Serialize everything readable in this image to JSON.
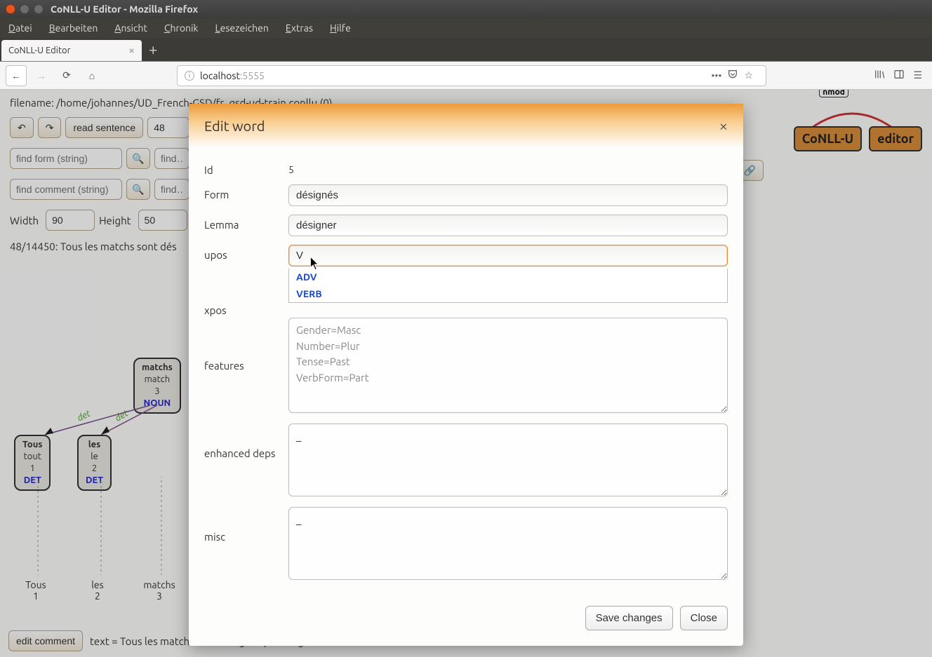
{
  "window": {
    "title": "CoNLL-U Editor - Mozilla Firefox"
  },
  "menu": {
    "items": [
      "Datei",
      "Bearbeiten",
      "Ansicht",
      "Chronik",
      "Lesezeichen",
      "Extras",
      "Hilfe"
    ]
  },
  "tab": {
    "title": "CoNLL-U Editor"
  },
  "url": {
    "host": "localhost",
    "port": ":5555"
  },
  "page": {
    "filename_label": "filename: /home/johannes/UD_French-GSD/fr_gsd-ud-train.conllu (0)",
    "read_button": "read sentence",
    "read_value": "48",
    "find_form_placeholder": "find form (string)",
    "find_right_placeholder": "find…",
    "find_comment_placeholder": "find comment (string)",
    "find_right2_placeholder": "find…",
    "width_label": "Width",
    "width_value": "90",
    "height_label": "Height",
    "height_value": "50",
    "sentence_counter": "48/14450: Tous les matchs sont dés",
    "bottom_text_label": "text = Tous les matchs sont désignés par tirage au sort.",
    "edit_comment_btn": "edit comment",
    "logo_a": "CoNLL-U",
    "logo_b": "editor",
    "nmod_label": "nmod"
  },
  "nodes": {
    "matchs": {
      "form": "matchs",
      "lemma": "match",
      "idx": "3",
      "pos": "NOUN"
    },
    "tous": {
      "form": "Tous",
      "lemma": "tout",
      "idx": "1",
      "pos": "DET"
    },
    "les": {
      "form": "les",
      "lemma": "le",
      "idx": "2",
      "pos": "DET"
    }
  },
  "arcs": {
    "det1": "det",
    "det2": "det"
  },
  "gloss": {
    "c1": {
      "w": "Tous",
      "i": "1"
    },
    "c2": {
      "w": "les",
      "i": "2"
    },
    "c3": {
      "w": "matchs",
      "i": "3"
    }
  },
  "modal": {
    "title": "Edit word",
    "labels": {
      "id": "Id",
      "form": "Form",
      "lemma": "Lemma",
      "upos": "upos",
      "xpos": "xpos",
      "features": "features",
      "enhanced": "enhanced deps",
      "misc": "misc"
    },
    "values": {
      "id": "5",
      "form": "désignés",
      "lemma": "désigner",
      "upos": "V",
      "xpos": "",
      "features": "Gender=Masc\nNumber=Plur\nTense=Past\nVerbForm=Part",
      "enhanced": "_",
      "misc": "_"
    },
    "autocomplete": [
      "ADV",
      "VERB"
    ],
    "save_btn": "Save changes",
    "close_btn": "Close"
  }
}
